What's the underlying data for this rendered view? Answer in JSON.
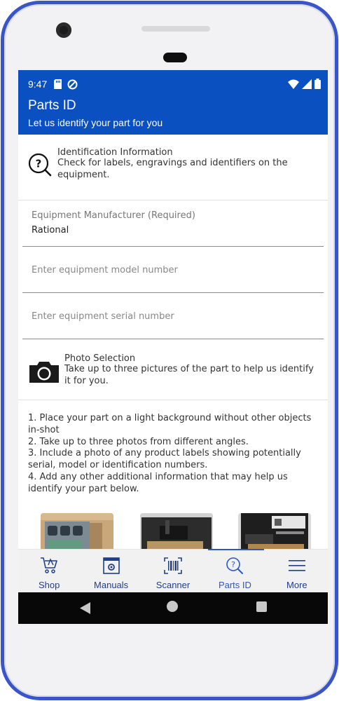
{
  "status_bar": {
    "time": "9:47"
  },
  "app_bar": {
    "title": "Parts ID",
    "subtitle": "Let us identify your part for you"
  },
  "identification": {
    "title": "Identification Information",
    "description": "Check for labels, engravings and identifiers on the equipment."
  },
  "form": {
    "manufacturer": {
      "label": "Equipment Manufacturer (Required)",
      "value": "Rational"
    },
    "model": {
      "placeholder": "Enter equipment model number",
      "value": ""
    },
    "serial": {
      "placeholder": "Enter equipment serial number",
      "value": ""
    }
  },
  "photo_selection": {
    "title": "Photo Selection",
    "description": "Take up to three pictures of the part to help us identify it for you."
  },
  "instructions": [
    "1. Place your part on a light background without other objects in-shot",
    "2. Take up to three photos from different angles.",
    "3. Include a photo of any product labels showing potentially serial, model or identification numbers.",
    "4. Add any other additional information that may help us identify your part below."
  ],
  "bottom_nav": {
    "items": [
      {
        "label": "Shop",
        "icon": "shop-icon"
      },
      {
        "label": "Manuals",
        "icon": "manuals-icon"
      },
      {
        "label": "Scanner",
        "icon": "barcode-icon"
      },
      {
        "label": "Parts ID",
        "icon": "parts-id-icon"
      },
      {
        "label": "More",
        "icon": "menu-icon"
      }
    ],
    "active": "Parts ID"
  },
  "colors": {
    "primary": "#0a50c1",
    "nav_text": "#1f3f8a",
    "frame": "#3a55c9"
  }
}
